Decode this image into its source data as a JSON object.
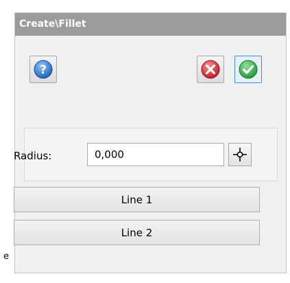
{
  "window": {
    "title": "Create\\Fillet"
  },
  "toolbar": {
    "help_icon": "help-icon",
    "cancel_icon": "cancel-icon",
    "ok_icon": "ok-check-icon"
  },
  "radius": {
    "label": "Radius:",
    "value": "0,000",
    "pick_icon": "crosshair-icon"
  },
  "lines": [
    {
      "label": "Line 1"
    },
    {
      "label": "Line 2"
    }
  ],
  "edge_text": "e",
  "colors": {
    "title_bar": "#9b9b9b",
    "help_blue": "#2f7fd4",
    "cancel_red": "#d9363e",
    "ok_green": "#35b44a",
    "active_border": "#3c8ee8"
  }
}
